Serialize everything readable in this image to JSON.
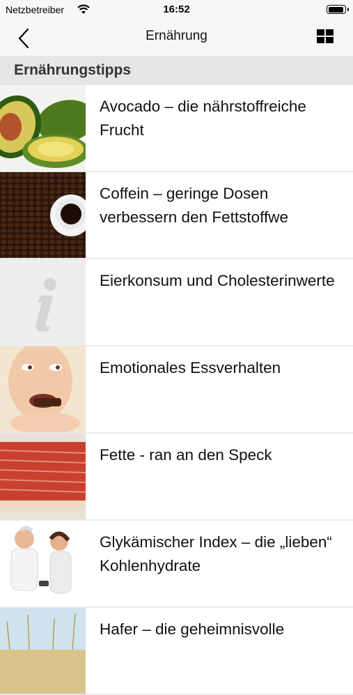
{
  "status_bar": {
    "carrier": "Netzbetreiber",
    "time": "16:52",
    "battery_level": 0.95
  },
  "nav": {
    "title": "Ernährung",
    "back_icon": "chevron-left-icon",
    "view_icon": "grid-icon"
  },
  "section": {
    "title": "Ernährungstipps"
  },
  "items": [
    {
      "label": "Avocado – die nährstoffreiche Frucht",
      "image": "avocado"
    },
    {
      "label": "Coffein – geringe Dosen verbessern den Fettstoffwe",
      "image": "coffee-beans"
    },
    {
      "label": "Eierkonsum und Cholesterinwerte",
      "image": "info-placeholder"
    },
    {
      "label": "Emotionales Essverhalten",
      "image": "woman-eating-chocolate"
    },
    {
      "label": "Fette - ran an den Speck",
      "image": "bacon"
    },
    {
      "label": "Glykämischer Index – die „lieben“ Kohlenhydrate",
      "image": "fitness-couple"
    },
    {
      "label": "Hafer – die geheimnisvolle",
      "image": "oat-field"
    }
  ],
  "colors": {
    "bar_bg": "#f7f7f7",
    "section_bg": "#e6e6e6",
    "divider": "#e9e9e9"
  }
}
